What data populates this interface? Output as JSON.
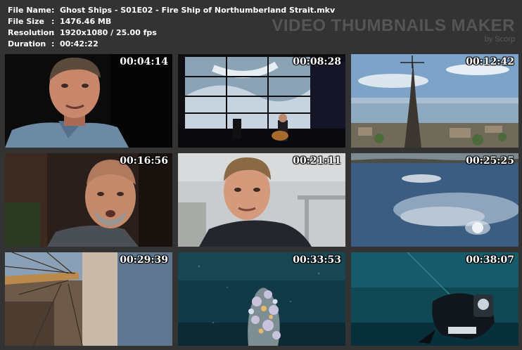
{
  "file_info": {
    "rows": [
      {
        "label": "File Name",
        "sep": ":",
        "value": "Ghost Ships - S01E02 - Fire Ship of Northumberland Strait.mkv"
      },
      {
        "label": "File Size",
        "sep": ":",
        "value": "1476.46 MB"
      },
      {
        "label": "Resolution",
        "sep": ":",
        "value": "1920x1080 / 25.00 fps"
      },
      {
        "label": "Duration",
        "sep": ":",
        "value": "00:42:22"
      }
    ]
  },
  "brand": {
    "title": "VIDEO THUMBNAILS MAKER",
    "subtitle": "by Scorp"
  },
  "thumbnails": [
    {
      "timestamp": "00:04:14",
      "scene": "man-interview"
    },
    {
      "timestamp": "00:08:28",
      "scene": "stage-performance"
    },
    {
      "timestamp": "00:12:42",
      "scene": "aerial-steeple"
    },
    {
      "timestamp": "00:16:56",
      "scene": "bald-man-interview"
    },
    {
      "timestamp": "00:21:11",
      "scene": "young-man-interview"
    },
    {
      "timestamp": "00:25:25",
      "scene": "water-reflection"
    },
    {
      "timestamp": "00:29:39",
      "scene": "ship-rigging"
    },
    {
      "timestamp": "00:33:53",
      "scene": "underwater-coral"
    },
    {
      "timestamp": "00:38:07",
      "scene": "scuba-diver"
    }
  ]
}
